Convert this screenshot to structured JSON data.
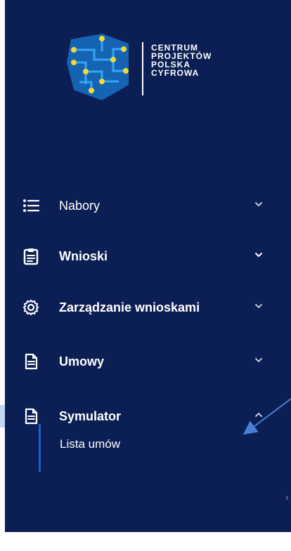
{
  "logo": {
    "line1": "CENTRUM",
    "line2": "PROJEKTÓW",
    "line3": "POLSKA",
    "line4": "CYFROWA"
  },
  "nav": {
    "items": [
      {
        "label": "Nabory",
        "icon": "list-icon",
        "expanded": false
      },
      {
        "label": "Wnioski",
        "icon": "clipboard-icon",
        "expanded": false
      },
      {
        "label": "Zarządzanie wnioskami",
        "icon": "gear-icon",
        "expanded": false
      },
      {
        "label": "Umowy",
        "icon": "document-icon",
        "expanded": false
      },
      {
        "label": "Symulator",
        "icon": "document-icon",
        "expanded": true
      }
    ],
    "submenu": {
      "items": [
        {
          "label": "Lista umów"
        }
      ]
    }
  },
  "colors": {
    "sidebar_bg": "#0c1f54",
    "accent": "#1f5fd1",
    "logo_dot": "#f6d92e",
    "annotation_arrow": "#4a7fd6"
  }
}
